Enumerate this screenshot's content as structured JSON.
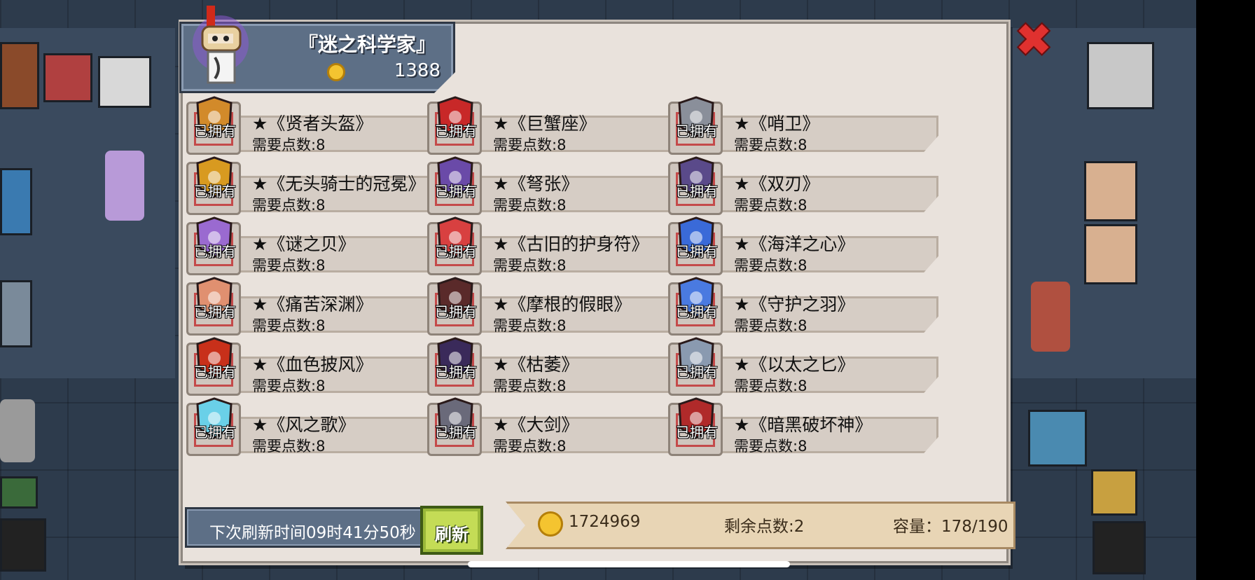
{
  "header": {
    "title": "『迷之科学家』",
    "coins": "1388"
  },
  "items": [
    {
      "name": "★《贤者头盔》",
      "cost": "需要点数:8",
      "owned": "已拥有",
      "icon": "helmet-icon",
      "color": "#d28a2a"
    },
    {
      "name": "★《巨蟹座》",
      "cost": "需要点数:8",
      "owned": "已拥有",
      "icon": "crab-icon",
      "color": "#c82828"
    },
    {
      "name": "★《哨卫》",
      "cost": "需要点数:8",
      "owned": "已拥有",
      "icon": "sentinel-helmet-icon",
      "color": "#8a8f9a"
    },
    {
      "name": "★《无头骑士的冠冕》",
      "cost": "需要点数:8",
      "owned": "已拥有",
      "icon": "crown-icon",
      "color": "#d89a20"
    },
    {
      "name": "★《弩张》",
      "cost": "需要点数:8",
      "owned": "已拥有",
      "icon": "bead-necklace-icon",
      "color": "#6a4aa8"
    },
    {
      "name": "★《双刃》",
      "cost": "需要点数:8",
      "owned": "已拥有",
      "icon": "twin-blade-icon",
      "color": "#5a4a8a"
    },
    {
      "name": "★《谜之贝》",
      "cost": "需要点数:8",
      "owned": "已拥有",
      "icon": "shell-icon",
      "color": "#9a6ad0"
    },
    {
      "name": "★《古旧的护身符》",
      "cost": "需要点数:8",
      "owned": "已拥有",
      "icon": "amulet-icon",
      "color": "#d84040"
    },
    {
      "name": "★《海洋之心》",
      "cost": "需要点数:8",
      "owned": "已拥有",
      "icon": "ocean-heart-icon",
      "color": "#3a6ad8"
    },
    {
      "name": "★《痛苦深渊》",
      "cost": "需要点数:8",
      "owned": "已拥有",
      "icon": "abyss-pendant-icon",
      "color": "#e09070"
    },
    {
      "name": "★《摩根的假眼》",
      "cost": "需要点数:8",
      "owned": "已拥有",
      "icon": "false-eye-icon",
      "color": "#5a2a2a"
    },
    {
      "name": "★《守护之羽》",
      "cost": "需要点数:8",
      "owned": "已拥有",
      "icon": "feather-icon",
      "color": "#4a7ae0"
    },
    {
      "name": "★《血色披风》",
      "cost": "需要点数:8",
      "owned": "已拥有",
      "icon": "cape-icon",
      "color": "#c8301a"
    },
    {
      "name": "★《枯萎》",
      "cost": "需要点数:8",
      "owned": "已拥有",
      "icon": "demon-mask-icon",
      "color": "#3a2a5a"
    },
    {
      "name": "★《以太之匕》",
      "cost": "需要点数:8",
      "owned": "已拥有",
      "icon": "dagger-icon",
      "color": "#8a9ab0"
    },
    {
      "name": "★《风之歌》",
      "cost": "需要点数:8",
      "owned": "已拥有",
      "icon": "wind-bow-icon",
      "color": "#6ad0e8"
    },
    {
      "name": "★《大剑》",
      "cost": "需要点数:8",
      "owned": "已拥有",
      "icon": "greatsword-icon",
      "color": "#6a6a7a"
    },
    {
      "name": "★《暗黑破坏神》",
      "cost": "需要点数:8",
      "owned": "已拥有",
      "icon": "dark-sword-icon",
      "color": "#b02a2a"
    }
  ],
  "footer": {
    "timer": "下次刷新时间09时41分50秒",
    "refresh_label": "刷新",
    "gold": "1724969",
    "remaining_points": "剩余点数:2",
    "capacity": "容量：178/190"
  },
  "close_icon": "close-icon"
}
